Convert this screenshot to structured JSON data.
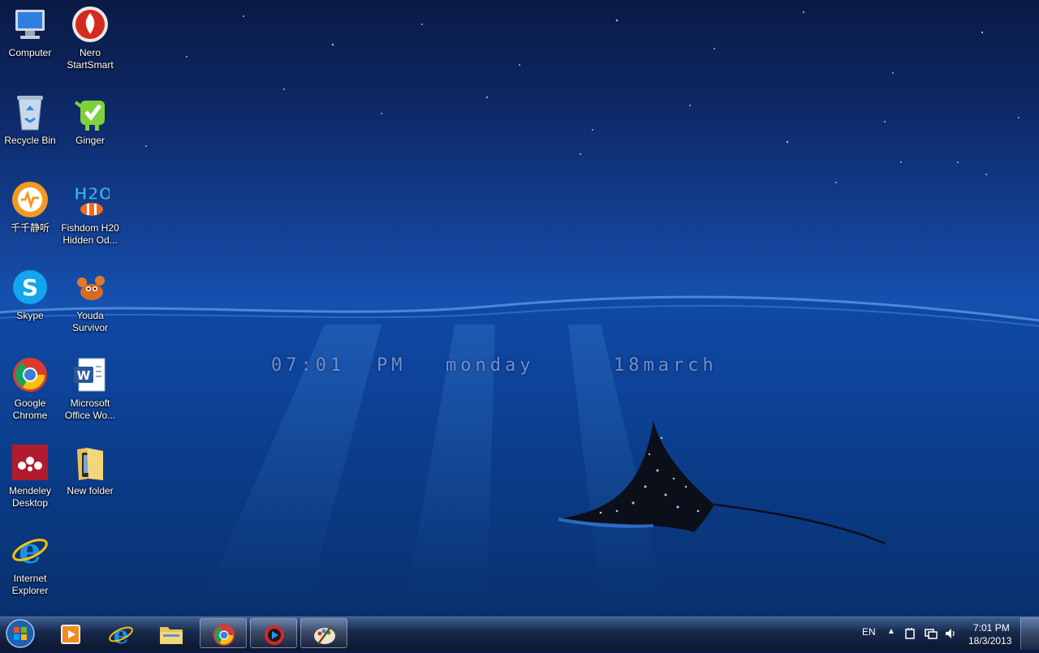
{
  "desktop": {
    "icons": [
      {
        "label": "Computer",
        "icon": "computer-icon"
      },
      {
        "label": "Nero StartSmart",
        "icon": "nero-icon"
      },
      {
        "label": "Recycle Bin",
        "icon": "recycle-bin-icon"
      },
      {
        "label": "Ginger",
        "icon": "ginger-icon"
      },
      {
        "label": "千千静听",
        "icon": "ttplayer-icon"
      },
      {
        "label": "Fishdom H20 Hidden Od...",
        "icon": "fishdom-icon"
      },
      {
        "label": "Skype",
        "icon": "skype-icon"
      },
      {
        "label": "Youda Survivor",
        "icon": "youda-icon"
      },
      {
        "label": "Google Chrome",
        "icon": "chrome-icon"
      },
      {
        "label": "Microsoft Office Wo...",
        "icon": "word-icon"
      },
      {
        "label": "Mendeley Desktop",
        "icon": "mendeley-icon"
      },
      {
        "label": "New folder",
        "icon": "folder-icon"
      },
      {
        "label": "Internet Explorer",
        "icon": "ie-icon"
      }
    ],
    "clock_widget": {
      "time": "07:01",
      "ampm": "PM",
      "day": "monday",
      "date": "18march"
    }
  },
  "taskbar": {
    "pinned": [
      {
        "icon": "media-player-icon",
        "active": false
      },
      {
        "icon": "ie-icon",
        "active": false
      },
      {
        "icon": "explorer-icon",
        "active": false
      },
      {
        "icon": "chrome-icon",
        "active": true
      },
      {
        "icon": "qvod-icon",
        "active": true
      },
      {
        "icon": "paint-icon",
        "active": true
      }
    ],
    "tray": {
      "language": "EN",
      "time": "7:01 PM",
      "date": "18/3/2013"
    }
  },
  "colors": {
    "ocean_dark": "#0a1a44",
    "ocean_mid": "#1552b0",
    "clock_text": "#6f8fcf"
  }
}
